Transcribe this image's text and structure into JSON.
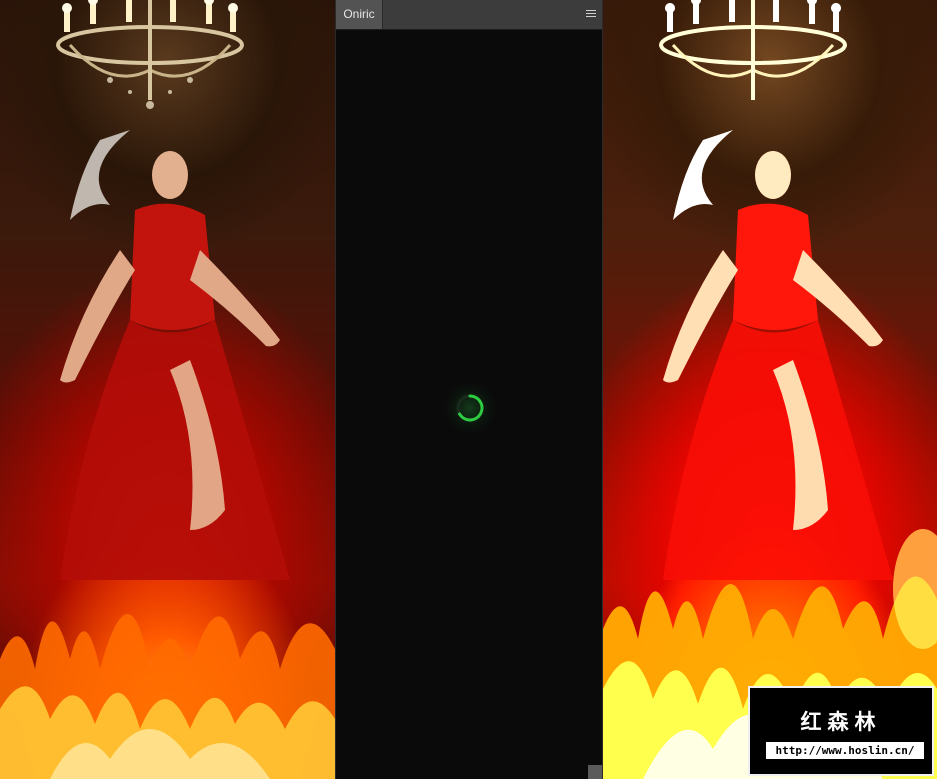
{
  "panel": {
    "tab_label": "Oniric",
    "menu_icon": "hamburger-menu-icon",
    "spinner_color": "#2ecc40"
  },
  "watermark": {
    "title": "红森林",
    "url": "http://www.hoslin.cn/"
  },
  "photos": {
    "left": "before-image",
    "right": "after-image"
  }
}
